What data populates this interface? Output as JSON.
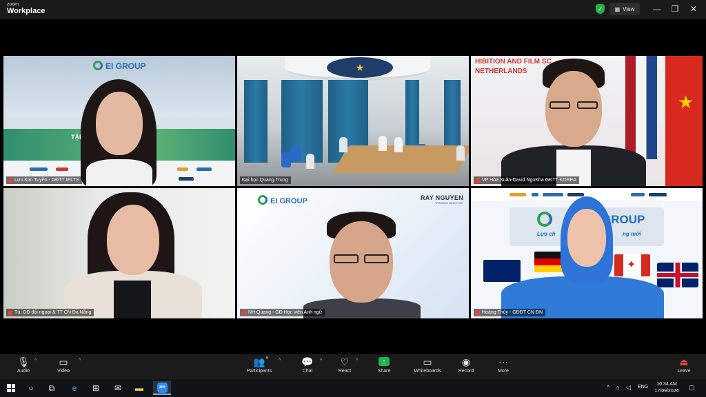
{
  "app": {
    "brand_line1": "zoom",
    "brand_line2": "Workplace",
    "view_label": "View"
  },
  "participants": [
    {
      "name": "Lưu Kim Tuyền - GĐTT IELTS",
      "background_text": "TẬP Đ",
      "logo_text": "EI GROUP"
    },
    {
      "name": "Đại học Quang Trung"
    },
    {
      "name": "VP Hòa Xuân-David NgoKha GĐTT KOREA",
      "background_text_1": "HIBITION AND FILM SC",
      "background_text_2": "NETHERLANDS"
    },
    {
      "name": "Tú: GĐ đối ngoại & TT CN Đà Nẵng"
    },
    {
      "name": "NH Quang - GĐ Học viện Anh ngữ",
      "logo_text": "EI GROUP",
      "presenter_name": "RAY NGUYEN",
      "presenter_role": "TRAINING DIRECTOR"
    },
    {
      "name": "Hoàng Thủy - GĐĐT CN ĐN",
      "board_text_1": "GROUP",
      "board_text_2": "Lựa ch",
      "board_text_3": "ng mới"
    }
  ],
  "toolbar": {
    "audio": "Audio",
    "video": "Video",
    "participants": "Participants",
    "participants_count": "6",
    "chat": "Chat",
    "react": "React",
    "share": "Share",
    "whiteboards": "Whiteboards",
    "record": "Record",
    "more": "More",
    "leave": "Leave"
  },
  "taskbar": {
    "language": "ENG",
    "time": "10:34 AM",
    "date": "17/09/2024",
    "zoom_icon_label": "zm"
  },
  "colors": {
    "active_speaker": "#3fd35b",
    "share_green": "#22b14c",
    "leave_red": "#e8433a",
    "zoom_blue": "#2d8cff"
  }
}
